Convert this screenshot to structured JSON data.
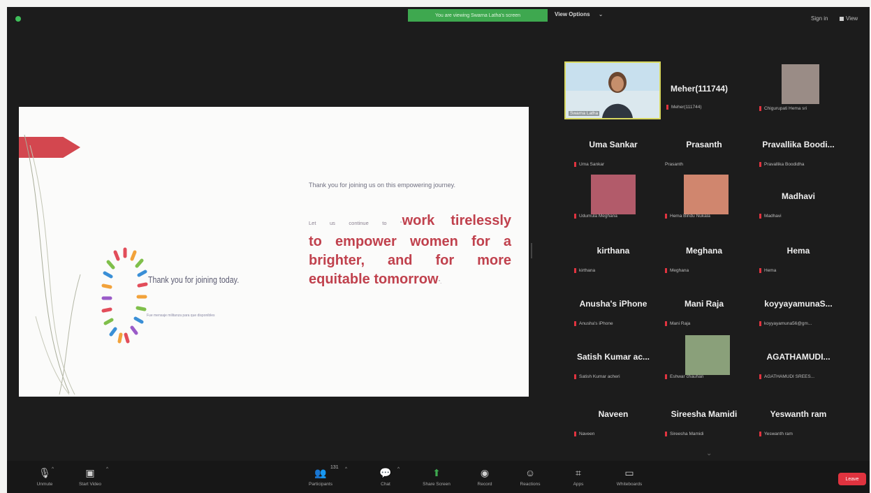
{
  "topbar": {
    "viewing_banner": "You are viewing Swarna Latha's screen",
    "view_options": "View Options",
    "sign_in": "Sign in",
    "view": "View"
  },
  "slide": {
    "heading": "Thank you for joining today.",
    "subline": "Fue mensaje militanza para que disponibles",
    "lead": "Thank you for joining us on this empowering journey.",
    "cont_prefix": "Let us continue to ",
    "cont_line1": "work tirelessly",
    "cont_line2": "to empower women for a",
    "cont_line3": "brighter, and for more",
    "cont_line4": "equitable tomorrow",
    "cont_suffix": "."
  },
  "participants": [
    {
      "id": "self",
      "label": "Swarna Latha",
      "kind": "video"
    },
    {
      "id": "meher",
      "name": "Meher(111744)",
      "label": "Meher(111744)"
    },
    {
      "id": "chigurupati",
      "label": "Chigurupati Hema sri",
      "kind": "avatar"
    },
    {
      "id": "uma",
      "name": "Uma Sankar",
      "label": "Uma Sankar"
    },
    {
      "id": "prasanth",
      "name": "Prasanth",
      "label": "Prasanth",
      "muted": false
    },
    {
      "id": "pravallika",
      "name": "Pravallika Boodi...",
      "label": "Pravallika Boodidha"
    },
    {
      "id": "udumula",
      "label": "Udumula Meghana",
      "kind": "avatar"
    },
    {
      "id": "hemabindu",
      "label": "Hema Bindu Nukala",
      "kind": "avatar"
    },
    {
      "id": "madhavi",
      "name": "Madhavi",
      "label": "Madhavi"
    },
    {
      "id": "kirthana",
      "name": "kirthana",
      "label": "kirthana"
    },
    {
      "id": "meghana",
      "name": "Meghana",
      "label": "Meghana"
    },
    {
      "id": "hema",
      "name": "Hema",
      "label": "Hema"
    },
    {
      "id": "anusha",
      "name": "Anusha's iPhone",
      "label": "Anusha's iPhone"
    },
    {
      "id": "mani",
      "name": "Mani Raja",
      "label": "Mani Raja"
    },
    {
      "id": "koyya",
      "name": "koyyayamunaS...",
      "label": "koyyayamuna56@gm..."
    },
    {
      "id": "satish",
      "name": "Satish Kumar ac...",
      "label": "Satish Kumar acheri"
    },
    {
      "id": "eshwar",
      "label": "Eshwar chauhan",
      "kind": "avatar"
    },
    {
      "id": "agatha",
      "name": "AGATHAMUDI...",
      "label": "AGATHAMUDI SREES..."
    },
    {
      "id": "naveen",
      "name": "Naveen",
      "label": "Naveen"
    },
    {
      "id": "sireesha",
      "name": "Sireesha Mamidi",
      "label": "Sireesha Mamidi"
    },
    {
      "id": "yeswanth",
      "name": "Yeswanth ram",
      "label": "Yeswanth ram"
    }
  ],
  "toolbar": {
    "unmute": "Unmute",
    "start_video": "Start Video",
    "participants": "Participants",
    "participant_count": "131",
    "chat": "Chat",
    "share_screen": "Share Screen",
    "record": "Record",
    "reactions": "Reactions",
    "apps": "Apps",
    "whiteboards": "Whiteboards",
    "leave": "Leave"
  },
  "colors": {
    "accent_green": "#3ea84f",
    "muted_red": "#e0333f",
    "slide_red": "#c0414d"
  }
}
